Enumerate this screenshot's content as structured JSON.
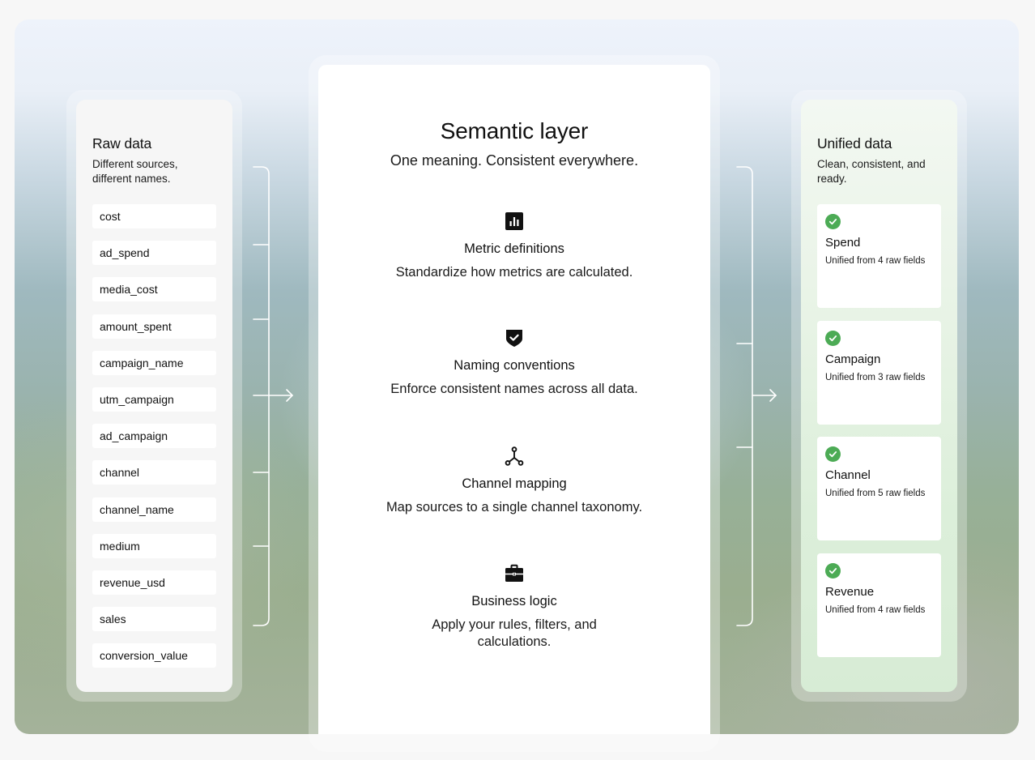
{
  "raw": {
    "title": "Raw data",
    "subtitle": "Different sources, different names.",
    "fields": [
      "cost",
      "ad_spend",
      "media_cost",
      "amount_spent",
      "campaign_name",
      "utm_campaign",
      "ad_campaign",
      "channel",
      "channel_name",
      "medium",
      "revenue_usd",
      "sales",
      "conversion_value"
    ]
  },
  "semantic": {
    "title": "Semantic layer",
    "subtitle": "One meaning. Consistent everywhere.",
    "features": [
      {
        "icon": "bar-chart-icon",
        "name": "Metric definitions",
        "desc": "Standardize how metrics are calculated."
      },
      {
        "icon": "shield-check-icon",
        "name": "Naming conventions",
        "desc": "Enforce consistent names across all data."
      },
      {
        "icon": "network-icon",
        "name": "Channel mapping",
        "desc": "Map sources to a single channel taxonomy."
      },
      {
        "icon": "briefcase-icon",
        "name": "Business logic",
        "desc": "Apply your rules, filters, and calculations."
      }
    ]
  },
  "unified": {
    "title": "Unified data",
    "subtitle": "Clean, consistent, and ready.",
    "items": [
      {
        "name": "Spend",
        "sub": "Unified from 4 raw fields"
      },
      {
        "name": "Campaign",
        "sub": "Unified from 3 raw fields"
      },
      {
        "name": "Channel",
        "sub": "Unified from 5 raw fields"
      },
      {
        "name": "Revenue",
        "sub": "Unified from 4 raw fields"
      }
    ]
  },
  "colors": {
    "check": "#4cab55",
    "connector": "#ffffff"
  }
}
